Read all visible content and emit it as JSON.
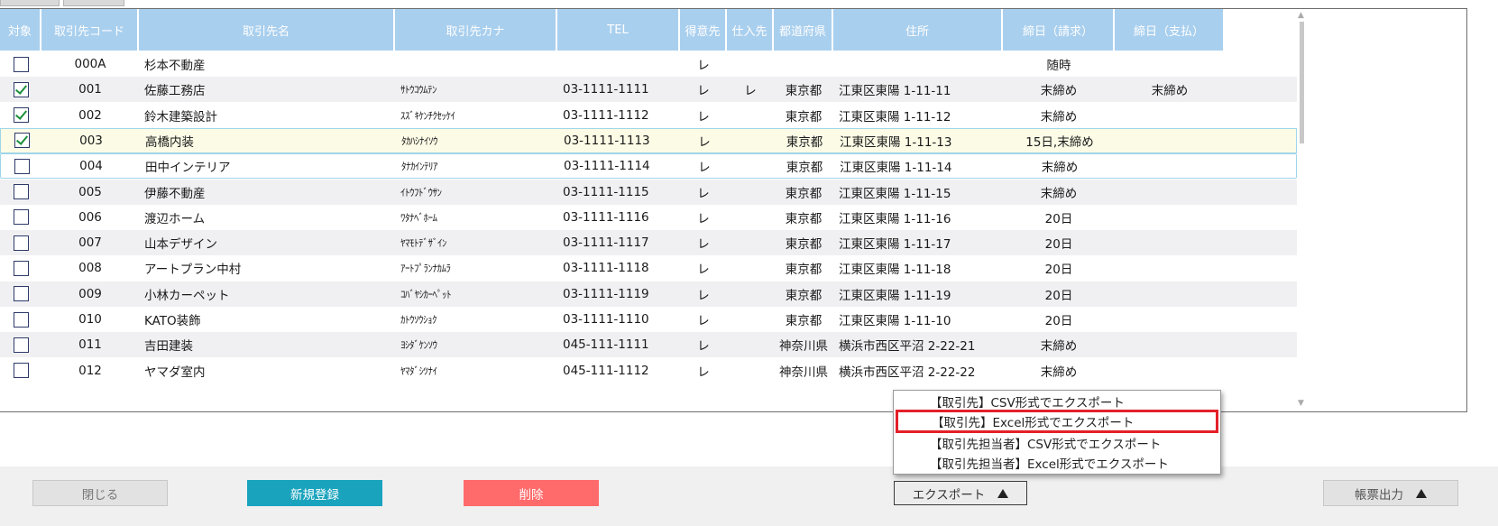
{
  "table": {
    "headers": [
      "対象",
      "取引先コード",
      "取引先名",
      "取引先カナ",
      "TEL",
      "得意先",
      "仕入先",
      "都道府県",
      "住所",
      "締日（請求）",
      "締日（支払）"
    ],
    "rows": [
      {
        "checked": false,
        "code": "000A",
        "name": "杉本不動産",
        "kana": "",
        "tel": "",
        "customer": "レ",
        "supplier": "",
        "pref": "",
        "addr": "",
        "bill": "随時",
        "pay": ""
      },
      {
        "checked": true,
        "code": "001",
        "name": "佐藤工務店",
        "kana": "ｻﾄｳｺｳﾑﾃﾝ",
        "tel": "03-1111-1111",
        "customer": "レ",
        "supplier": "レ",
        "pref": "東京都",
        "addr": "江東区東陽 1-11-11",
        "bill": "末締め",
        "pay": "末締め"
      },
      {
        "checked": true,
        "code": "002",
        "name": "鈴木建築設計",
        "kana": "ｽｽﾞｷｹﾝﾁｸｾｯｹｲ",
        "tel": "03-1111-1112",
        "customer": "レ",
        "supplier": "",
        "pref": "東京都",
        "addr": "江東区東陽 1-11-12",
        "bill": "末締め",
        "pay": ""
      },
      {
        "checked": true,
        "code": "003",
        "name": "高橋内装",
        "kana": "ﾀｶﾊｼﾅｲｿｳ",
        "tel": "03-1111-1113",
        "customer": "レ",
        "supplier": "",
        "pref": "東京都",
        "addr": "江東区東陽 1-11-13",
        "bill": "15日,末締め",
        "pay": ""
      },
      {
        "checked": false,
        "code": "004",
        "name": "田中インテリア",
        "kana": "ﾀﾅｶｲﾝﾃﾘｱ",
        "tel": "03-1111-1114",
        "customer": "レ",
        "supplier": "",
        "pref": "東京都",
        "addr": "江東区東陽 1-11-14",
        "bill": "末締め",
        "pay": ""
      },
      {
        "checked": false,
        "code": "005",
        "name": "伊藤不動産",
        "kana": "ｲﾄｳﾌﾄﾞｳｻﾝ",
        "tel": "03-1111-1115",
        "customer": "レ",
        "supplier": "",
        "pref": "東京都",
        "addr": "江東区東陽 1-11-15",
        "bill": "末締め",
        "pay": ""
      },
      {
        "checked": false,
        "code": "006",
        "name": "渡辺ホーム",
        "kana": "ﾜﾀﾅﾍﾞﾎｰﾑ",
        "tel": "03-1111-1116",
        "customer": "レ",
        "supplier": "",
        "pref": "東京都",
        "addr": "江東区東陽 1-11-16",
        "bill": "20日",
        "pay": ""
      },
      {
        "checked": false,
        "code": "007",
        "name": "山本デザイン",
        "kana": "ﾔﾏﾓﾄﾃﾞｻﾞｲﾝ",
        "tel": "03-1111-1117",
        "customer": "レ",
        "supplier": "",
        "pref": "東京都",
        "addr": "江東区東陽 1-11-17",
        "bill": "20日",
        "pay": ""
      },
      {
        "checked": false,
        "code": "008",
        "name": "アートプラン中村",
        "kana": "ｱｰﾄﾌﾟﾗﾝﾅｶﾑﾗ",
        "tel": "03-1111-1118",
        "customer": "レ",
        "supplier": "",
        "pref": "東京都",
        "addr": "江東区東陽 1-11-18",
        "bill": "20日",
        "pay": ""
      },
      {
        "checked": false,
        "code": "009",
        "name": "小林カーペット",
        "kana": "ｺﾊﾞﾔｼｶｰﾍﾟｯﾄ",
        "tel": "03-1111-1119",
        "customer": "レ",
        "supplier": "",
        "pref": "東京都",
        "addr": "江東区東陽 1-11-19",
        "bill": "20日",
        "pay": ""
      },
      {
        "checked": false,
        "code": "010",
        "name": "KATO装飾",
        "kana": "ｶﾄｳｿｳｼｮｸ",
        "tel": "03-1111-1110",
        "customer": "レ",
        "supplier": "",
        "pref": "東京都",
        "addr": "江東区東陽 1-11-10",
        "bill": "20日",
        "pay": ""
      },
      {
        "checked": false,
        "code": "011",
        "name": "吉田建装",
        "kana": "ﾖｼﾀﾞｹﾝｿｳ",
        "tel": "045-111-1111",
        "customer": "レ",
        "supplier": "",
        "pref": "神奈川県",
        "addr": "横浜市西区平沼 2-22-21",
        "bill": "末締め",
        "pay": ""
      },
      {
        "checked": false,
        "code": "012",
        "name": "ヤマダ室内",
        "kana": "ﾔﾏﾀﾞｼﾂﾅｲ",
        "tel": "045-111-1112",
        "customer": "レ",
        "supplier": "",
        "pref": "神奈川県",
        "addr": "横浜市西区平沼 2-22-22",
        "bill": "末締め",
        "pay": ""
      }
    ]
  },
  "export_menu": {
    "items": [
      "【取引先】CSV形式でエクスポート",
      "【取引先】Excel形式でエクスポート",
      "【取引先担当者】CSV形式でエクスポート",
      "【取引先担当者】Excel形式でエクスポート"
    ]
  },
  "footer": {
    "close_label": "閉じる",
    "new_label": "新規登録",
    "delete_label": "削除",
    "export_label": "エクスポート",
    "report_label": "帳票出力"
  },
  "colors": {
    "header_bg": "#a9cfee",
    "new_button": "#1aa3bd",
    "delete_button": "#ff6b6b",
    "highlight_border": "#e3202a",
    "selected_row": "#fcfbe6"
  }
}
